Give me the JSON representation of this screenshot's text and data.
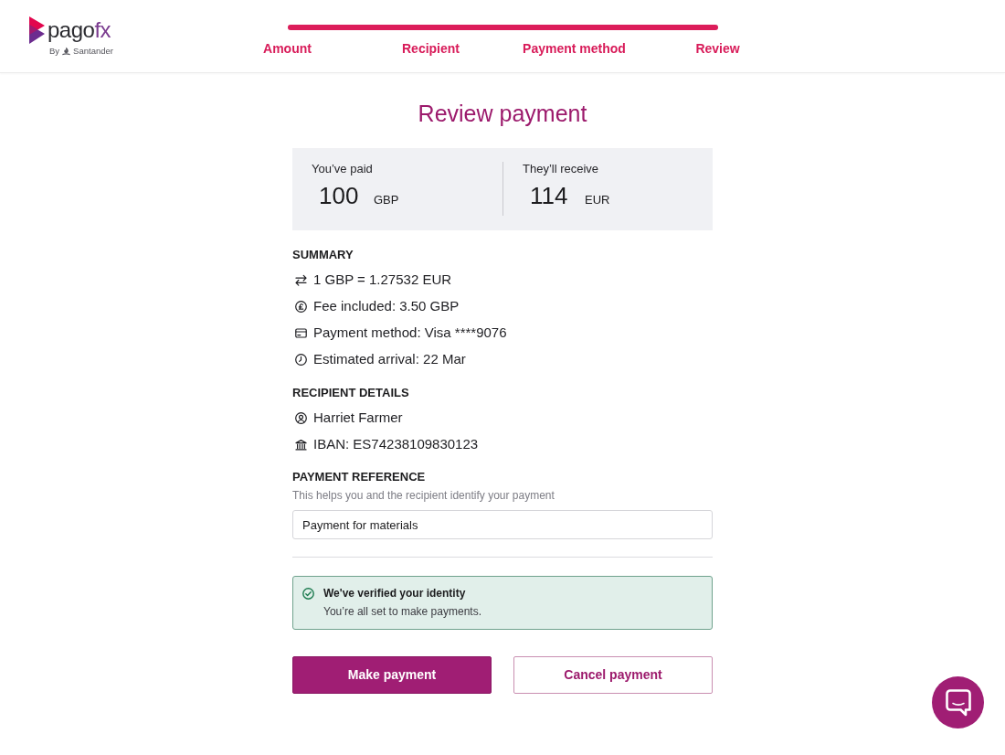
{
  "brand": {
    "name": "pago",
    "name_accent": "fx",
    "byline": "By",
    "partner": "Santander"
  },
  "progress": {
    "level": 1,
    "steps": [
      {
        "label": "Amount",
        "done": true
      },
      {
        "label": "Recipient",
        "done": true
      },
      {
        "label": "Payment method",
        "done": true
      },
      {
        "label": "Review",
        "done": true
      }
    ]
  },
  "title": "Review payment",
  "amounts": [
    {
      "label": "You’ve paid",
      "amount": "100",
      "currency": "GBP"
    },
    {
      "label": "They’ll receive",
      "amount": "114",
      "currency": "EUR"
    }
  ],
  "sections": [
    {
      "heading": "SUMMARY",
      "items": [
        {
          "kind": "rate",
          "text": "1 GBP = 1.27532 EUR"
        },
        {
          "kind": "fee",
          "text": "Fee included: 3.50 GBP"
        },
        {
          "kind": "card",
          "text": "Payment method: Visa ****9076"
        },
        {
          "kind": "arrival",
          "text": "Estimated arrival: 22 Mar"
        }
      ]
    },
    {
      "heading": "RECIPIENT DETAILS",
      "items": [
        {
          "kind": "person",
          "text": "Harriet Farmer"
        },
        {
          "kind": "bank",
          "text": "IBAN: ES74238109830123"
        }
      ]
    }
  ],
  "payment_reference": {
    "heading": "PAYMENT REFERENCE",
    "hint": "This helps you and the recipient identify your payment",
    "value": "Payment for materials"
  },
  "notice": {
    "title": "We've verified your identity",
    "text": "You’re all set to make payments."
  },
  "buttons": [
    {
      "kind": "primary",
      "label": "Make payment"
    },
    {
      "kind": "secondary",
      "label": "Cancel payment"
    }
  ]
}
